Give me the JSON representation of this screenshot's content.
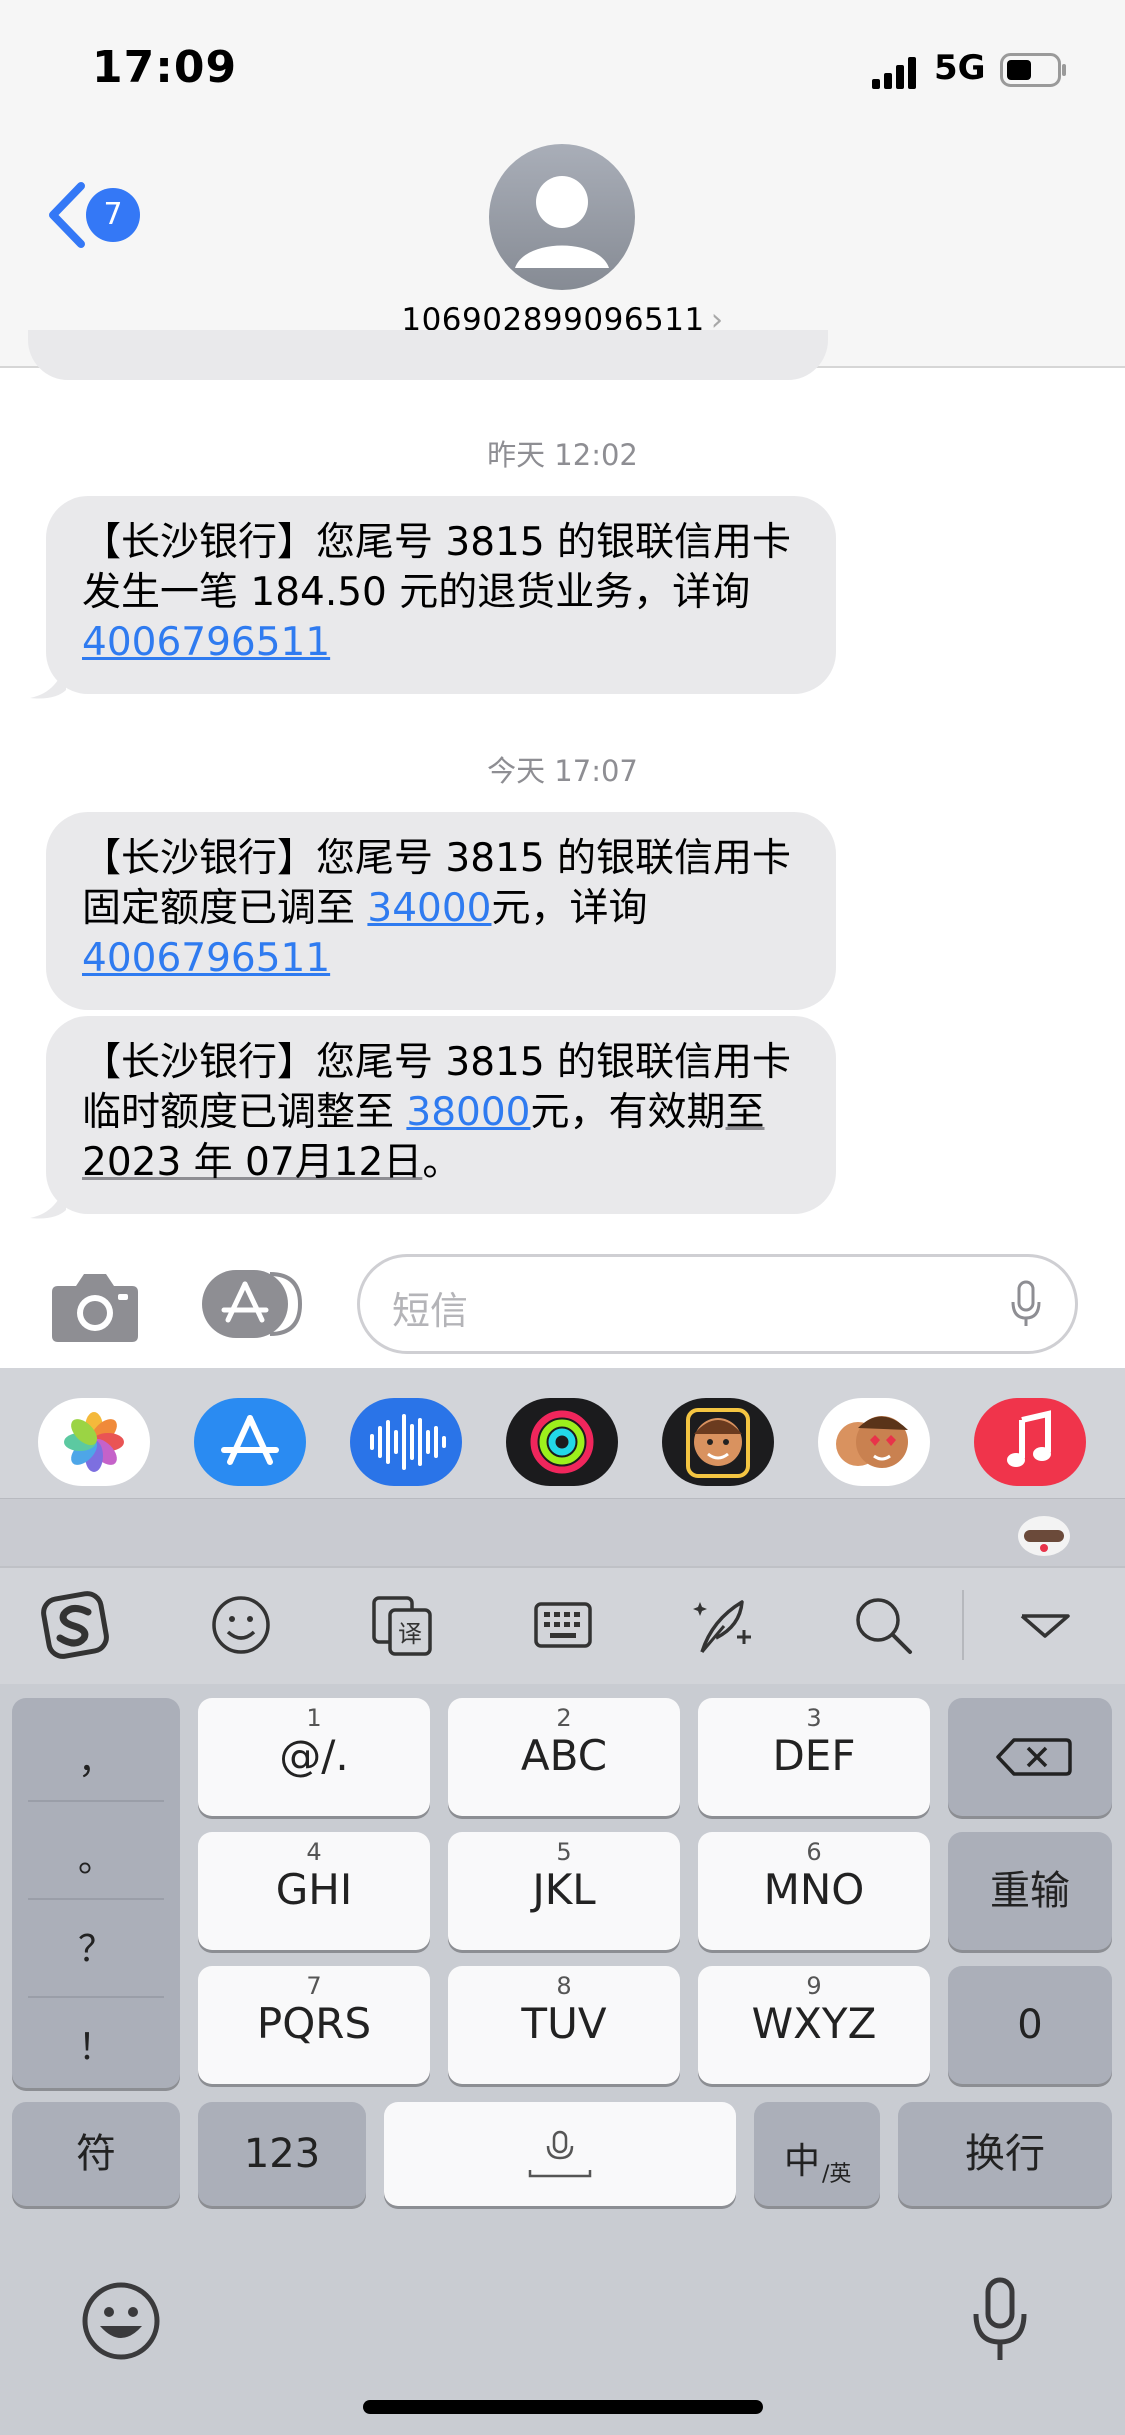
{
  "status_bar": {
    "time": "17:09",
    "network": "5G"
  },
  "header": {
    "back_count": "7",
    "contact": "106902899096511",
    "contact_chevron": "›"
  },
  "messages": [
    {
      "timestamp": "昨天 12:02",
      "lines": [
        "【长沙银行】您尾号 3815 的银联信用卡",
        "发生一笔 184.50 元的退货业务，详询"
      ],
      "link": "4006796511"
    },
    {
      "timestamp": "今天 17:07",
      "line1": "【长沙银行】您尾号 3815 的银联信用卡",
      "line2_pre": "固定额度已调至 ",
      "line2_link": "34000",
      "line2_post": "元，详询",
      "link": "4006796511"
    },
    {
      "line1": "【长沙银行】您尾号 3815 的银联信用卡",
      "line2_pre": "临时额度已调整至 ",
      "line2_link": "38000",
      "line2_mid": "元，有效期",
      "line2_under": "至",
      "line3_under": "2023 年 07月12日",
      "line3_post": "。"
    }
  ],
  "composer": {
    "placeholder": "短信"
  },
  "app_drawer": [
    "photos-app",
    "app-store-app",
    "voice-memo-app",
    "activity-app",
    "memoji-app",
    "animoji-stickers-app",
    "music-app"
  ],
  "keyboard": {
    "punctuation": [
      "，",
      "。",
      "？",
      "！"
    ],
    "rows": [
      [
        {
          "num": "1",
          "label": "@/."
        },
        {
          "num": "2",
          "label": "ABC"
        },
        {
          "num": "3",
          "label": "DEF"
        }
      ],
      [
        {
          "num": "4",
          "label": "GHI"
        },
        {
          "num": "5",
          "label": "JKL"
        },
        {
          "num": "6",
          "label": "MNO"
        }
      ],
      [
        {
          "num": "7",
          "label": "PQRS"
        },
        {
          "num": "8",
          "label": "TUV"
        },
        {
          "num": "9",
          "label": "WXYZ"
        }
      ]
    ],
    "reenter": "重输",
    "zero": "0",
    "symbols": "符",
    "numbers": "123",
    "lang_main": "中",
    "lang_sub": "/英",
    "return": "换行"
  }
}
